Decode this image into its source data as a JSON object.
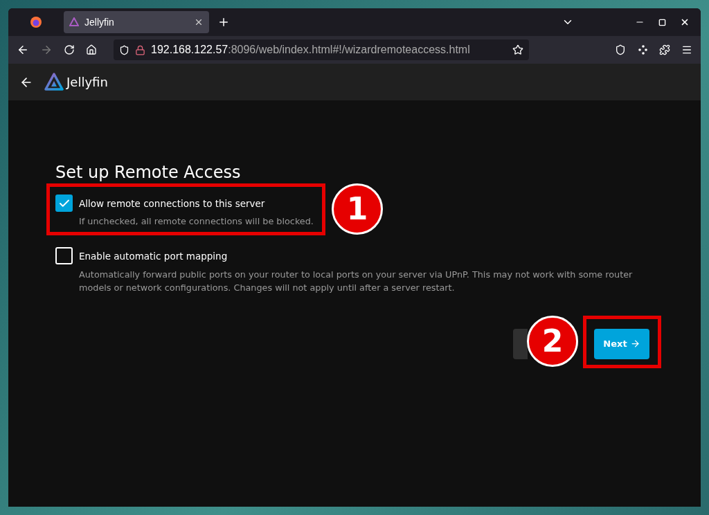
{
  "browser": {
    "tabs": [
      {
        "title": "Jellyfin",
        "selected": true
      }
    ],
    "url": {
      "host": "192.168.122.57",
      "rest": ":8096/web/index.html#!/wizardremoteaccess.html"
    }
  },
  "app": {
    "name": "Jellyfin"
  },
  "page": {
    "title": "Set up Remote Access",
    "options": [
      {
        "label": "Allow remote connections to this server",
        "description": "If unchecked, all remote connections will be blocked.",
        "checked": true
      },
      {
        "label": "Enable automatic port mapping",
        "description": "Automatically forward public ports on your router to local ports on your server via UPnP. This may not work with some router models or network configurations. Changes will not apply until after a server restart.",
        "checked": false
      }
    ],
    "buttons": [
      {
        "kind": "previous"
      },
      {
        "kind": "next",
        "label": "Next"
      }
    ]
  },
  "annotations": [
    {
      "number": "1"
    },
    {
      "number": "2"
    }
  ]
}
